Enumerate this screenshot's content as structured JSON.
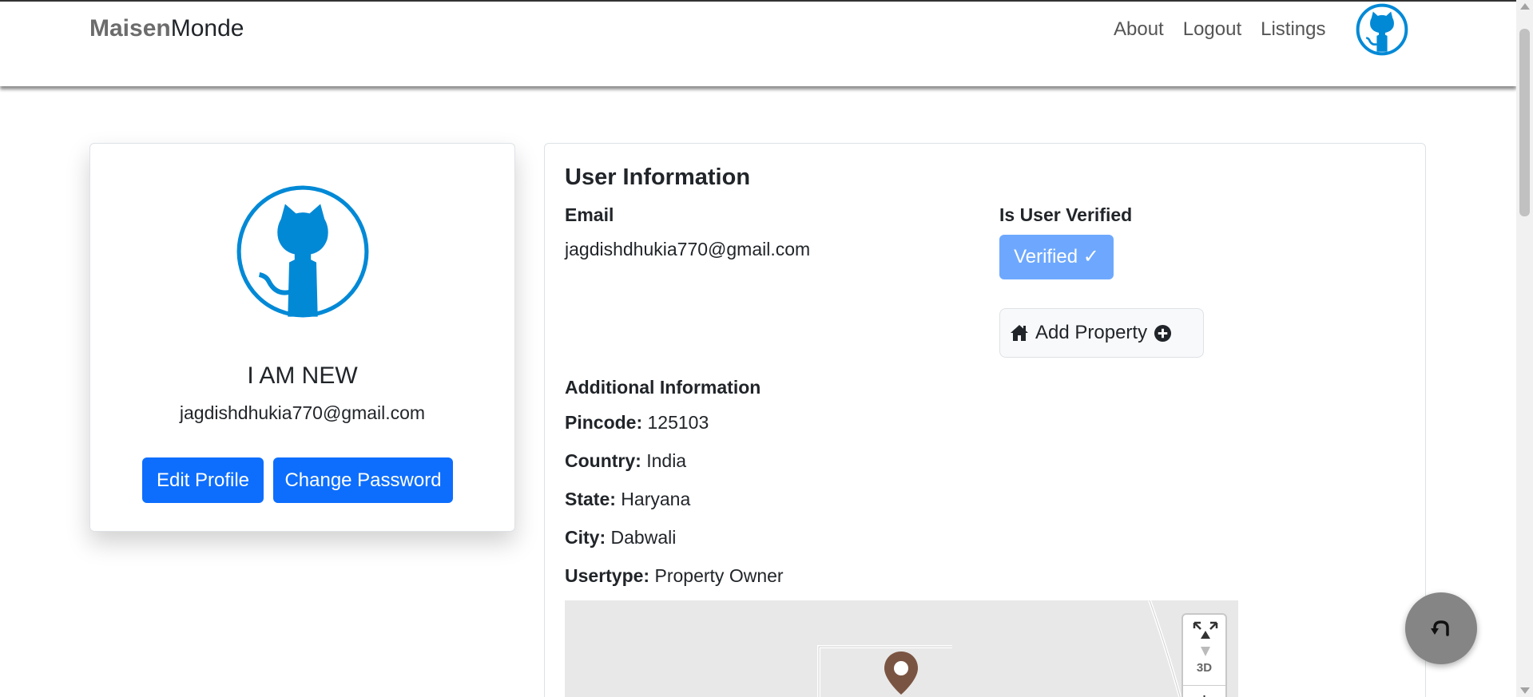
{
  "navbar": {
    "brand_bold": "Maisen",
    "brand_regular": "Monde",
    "links": [
      "About",
      "Logout",
      "Listings"
    ],
    "avatar_icon": "github-octocat-icon"
  },
  "profile": {
    "name": "I AM NEW",
    "email": "jagdishdhukia770@gmail.com",
    "edit_button": "Edit Profile",
    "password_button": "Change Password",
    "avatar_icon": "github-octocat-icon"
  },
  "user_info": {
    "title": "User Information",
    "email_label": "Email",
    "email_value": "jagdishdhukia770@gmail.com",
    "verified_label": "Is User Verified",
    "verified_badge": "Verified ✓",
    "add_property_label": "Add Property",
    "additional_title": "Additional Information",
    "details": [
      {
        "label": "Pincode:",
        "value": " 125103"
      },
      {
        "label": "Country:",
        "value": " India"
      },
      {
        "label": "State:",
        "value": " Haryana"
      },
      {
        "label": "City:",
        "value": " Dabwali"
      },
      {
        "label": "Usertype:",
        "value": " Property Owner"
      }
    ]
  },
  "map": {
    "control_3d": "3D",
    "control_zoom_in": "+",
    "marker_icon": "map-pin-icon"
  },
  "colors": {
    "primary": "#0d6efd",
    "verified": "#6ea8fe",
    "avatar": "#0189d6",
    "marker": "#7a5442"
  }
}
